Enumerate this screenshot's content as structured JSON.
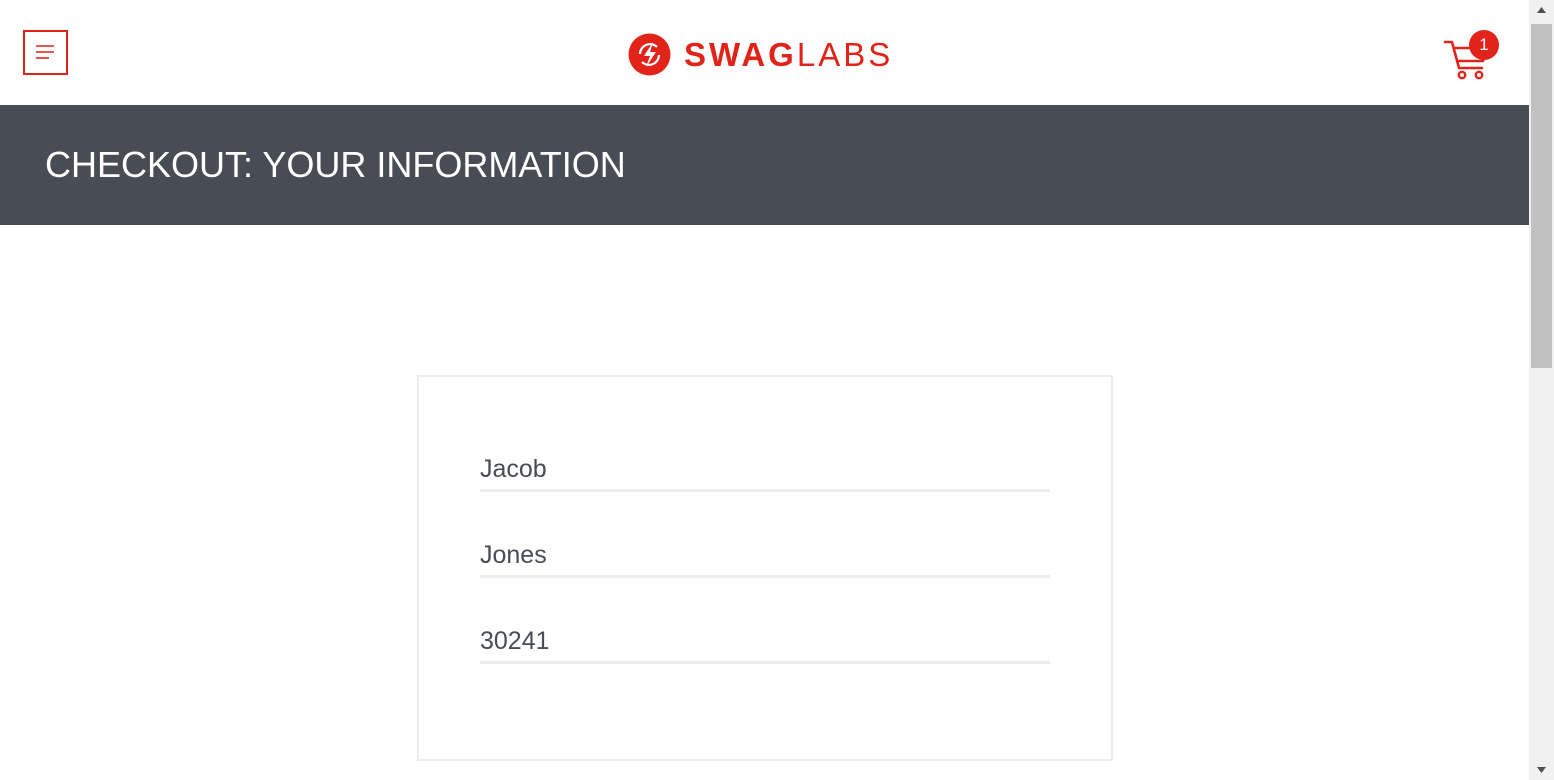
{
  "header": {
    "logo": {
      "bold": "SWAG",
      "light": "LABS"
    },
    "cart_count": "1"
  },
  "subheader": {
    "title": "CHECKOUT: YOUR INFORMATION"
  },
  "form": {
    "first_name": "Jacob",
    "last_name": "Jones",
    "postal_code": "30241"
  },
  "colors": {
    "brand_red": "#e2231a",
    "subheader_bg": "#474c55",
    "text": "#484c55",
    "border": "#ededed"
  },
  "icons": [
    "menu-icon",
    "swag-labs-logo-icon",
    "cart-icon"
  ]
}
